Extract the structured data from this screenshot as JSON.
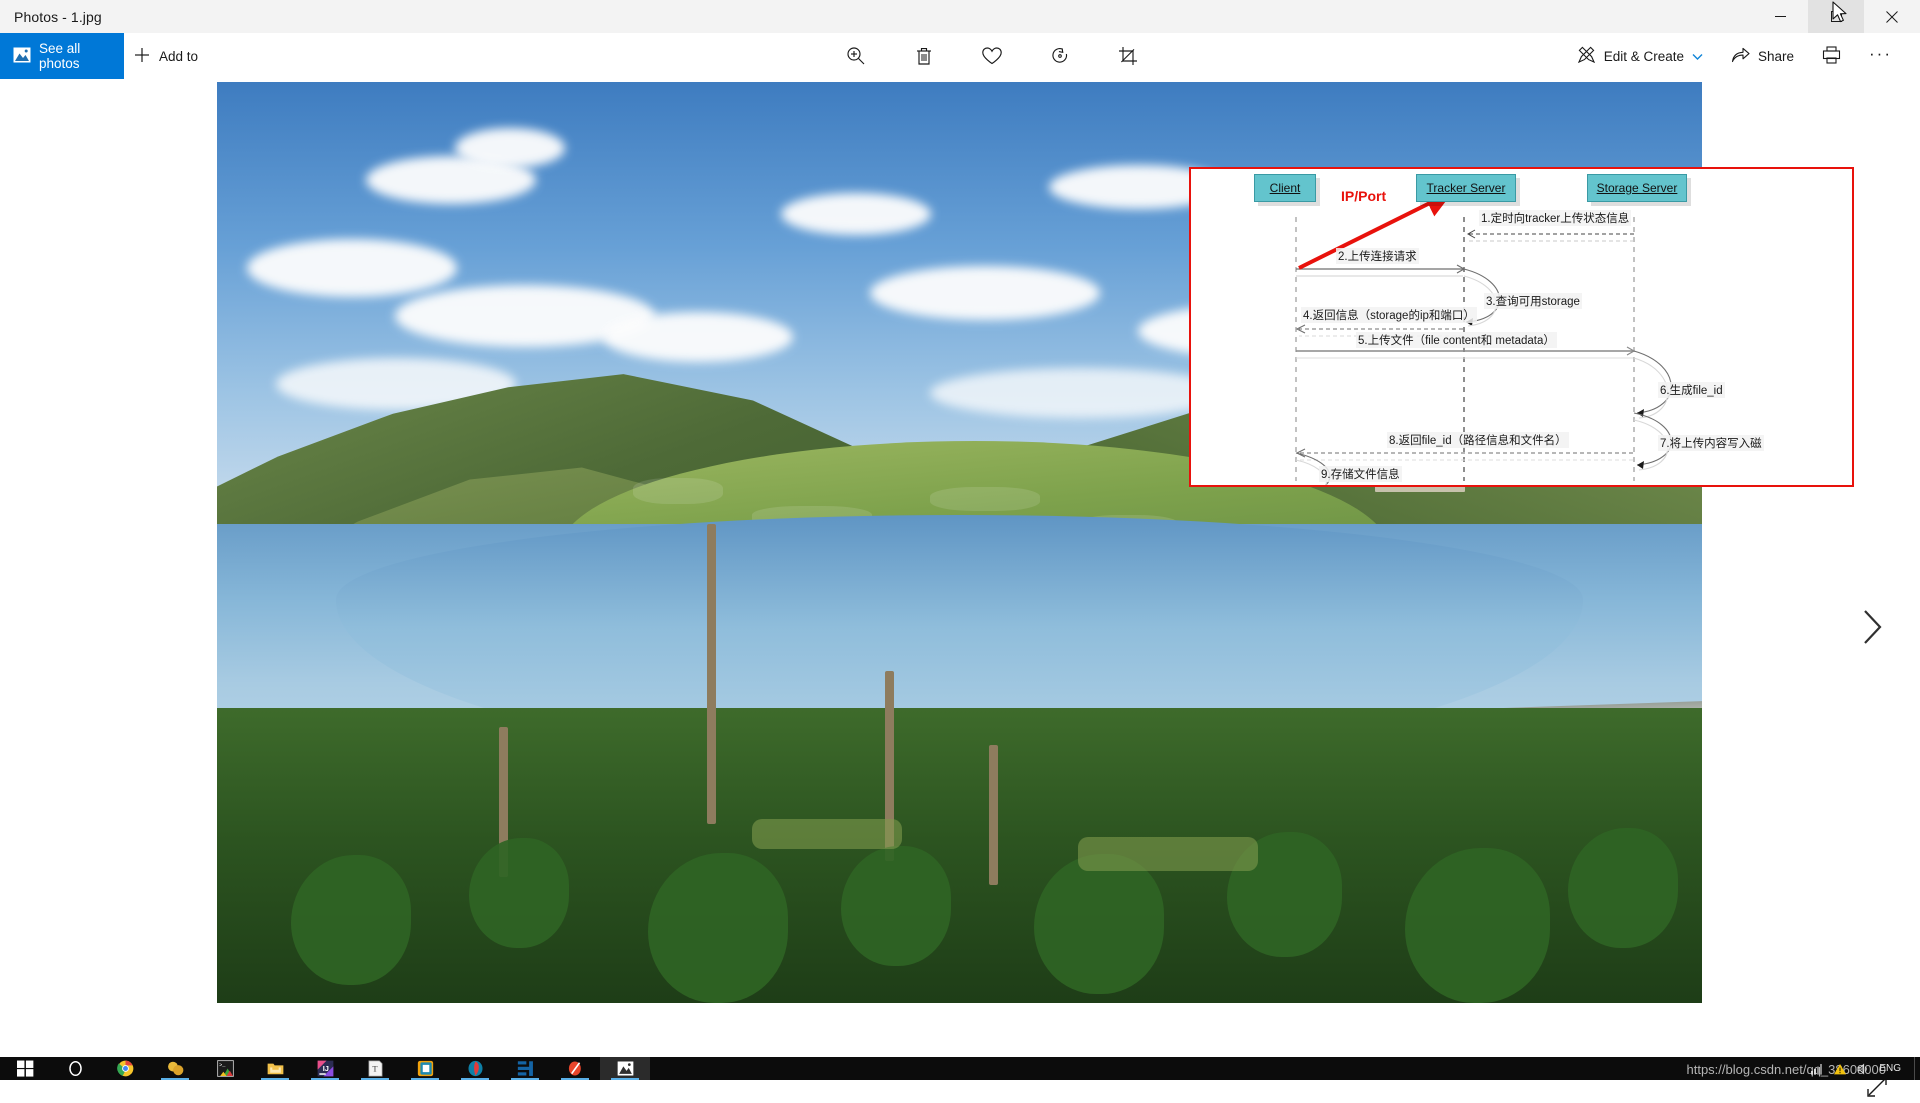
{
  "window": {
    "title": "Photos - 1.jpg",
    "minimize_label": "Minimize",
    "maximize_label": "Maximize",
    "close_label": "Close"
  },
  "commandbar": {
    "see_all_photos": "See all photos",
    "add_to": "Add to",
    "zoom_label": "Zoom",
    "delete_label": "Delete",
    "favorite_label": "Add to favorites",
    "rotate_label": "Rotate",
    "crop_label": "Crop & rotate",
    "edit_create": "Edit & Create",
    "share": "Share",
    "print_label": "Print",
    "more_label": "See more"
  },
  "viewer": {
    "next_label": "Next",
    "fullscreen_label": "Full screen"
  },
  "diagram": {
    "border_color": "#e8120c",
    "box_color": "#63c4cd",
    "lifelines": [
      {
        "label": "Client"
      },
      {
        "label": "Tracker Server"
      },
      {
        "label": "Storage Server"
      }
    ],
    "annotation": "IP/Port",
    "messages": [
      {
        "n": "1",
        "text": "1.定时向tracker上传状态信息"
      },
      {
        "n": "2",
        "text": "2.上传连接请求"
      },
      {
        "n": "3",
        "text": "3.查询可用storage"
      },
      {
        "n": "4",
        "text": "4.返回信息（storage的ip和端口）"
      },
      {
        "n": "5",
        "text": "5.上传文件（file content和 metadata）"
      },
      {
        "n": "6",
        "text": "6.生成file_id"
      },
      {
        "n": "7",
        "text": "7.将上传内容写入磁"
      },
      {
        "n": "8",
        "text": "8.返回file_id（路径信息和文件名）"
      },
      {
        "n": "9",
        "text": "9.存储文件信息"
      }
    ]
  },
  "taskbar": {
    "items": [
      {
        "name": "start",
        "label": "Start"
      },
      {
        "name": "cortana",
        "label": "Search"
      },
      {
        "name": "chrome",
        "label": "Google Chrome"
      },
      {
        "name": "navicat",
        "label": "Navicat"
      },
      {
        "name": "terminal",
        "label": "Terminal"
      },
      {
        "name": "explorer",
        "label": "File Explorer"
      },
      {
        "name": "intellij-idea",
        "label": "IntelliJ IDEA"
      },
      {
        "name": "typora",
        "label": "Typora"
      },
      {
        "name": "xshell",
        "label": "Xshell"
      },
      {
        "name": "postman",
        "label": "Postman"
      },
      {
        "name": "editplus",
        "label": "EditPlus"
      },
      {
        "name": "xmind",
        "label": "XMind"
      },
      {
        "name": "photos",
        "label": "Photos"
      }
    ],
    "tray": {
      "language": "ENG",
      "clock_time": "",
      "watermark": "https://blog.csdn.net/qq_38608000"
    }
  }
}
